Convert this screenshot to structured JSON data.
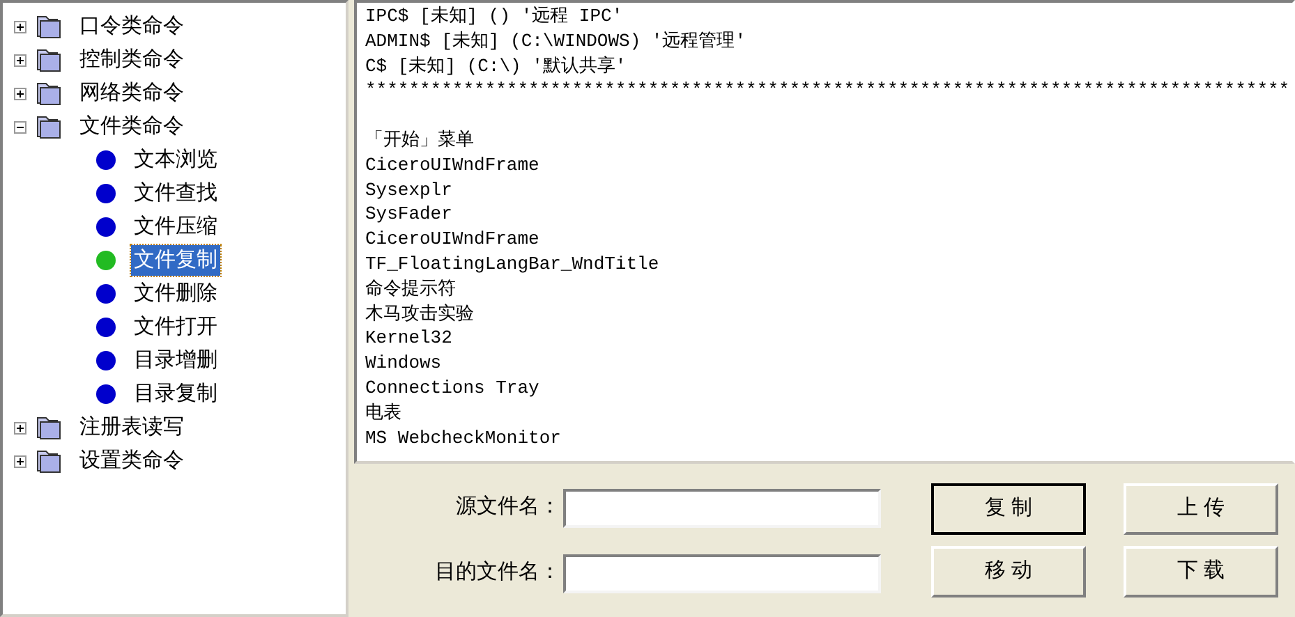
{
  "tree": [
    {
      "label": "口令类命令",
      "expanded": false
    },
    {
      "label": "控制类命令",
      "expanded": false
    },
    {
      "label": "网络类命令",
      "expanded": false
    },
    {
      "label": "文件类命令",
      "expanded": true,
      "children": [
        {
          "label": "文本浏览",
          "selected": false,
          "color": "#0000cc"
        },
        {
          "label": "文件查找",
          "selected": false,
          "color": "#0000cc"
        },
        {
          "label": "文件压缩",
          "selected": false,
          "color": "#0000cc"
        },
        {
          "label": "文件复制",
          "selected": true,
          "color": "#22bb22"
        },
        {
          "label": "文件删除",
          "selected": false,
          "color": "#0000cc"
        },
        {
          "label": "文件打开",
          "selected": false,
          "color": "#0000cc"
        },
        {
          "label": "目录增删",
          "selected": false,
          "color": "#0000cc"
        },
        {
          "label": "目录复制",
          "selected": false,
          "color": "#0000cc"
        }
      ]
    },
    {
      "label": "注册表读写",
      "expanded": false
    },
    {
      "label": "设置类命令",
      "expanded": false
    }
  ],
  "output_blocks": [
    [
      "IPC$ [未知] () '远程 IPC'",
      "ADMIN$ [未知] (C:\\WINDOWS) '远程管理'",
      "C$ [未知] (C:\\) '默认共享'",
      "*************************************************************************************"
    ],
    [
      "「开始」菜单",
      "CiceroUIWndFrame",
      "Sysexplr",
      "SysFader",
      "CiceroUIWndFrame",
      "TF_FloatingLangBar_WndTitle",
      "命令提示符",
      "木马攻击实验",
      "Kernel32",
      "Windows",
      "Connections Tray",
      "电表",
      "MS WebcheckMonitor"
    ]
  ],
  "fields": [
    {
      "label": "源文件名："
    },
    {
      "label": "目的文件名："
    }
  ],
  "buttons": [
    [
      {
        "label": "复 制",
        "default": true
      },
      {
        "label": "上 传",
        "default": false
      }
    ],
    [
      {
        "label": "移 动",
        "default": false
      },
      {
        "label": "下 载",
        "default": false
      }
    ]
  ]
}
